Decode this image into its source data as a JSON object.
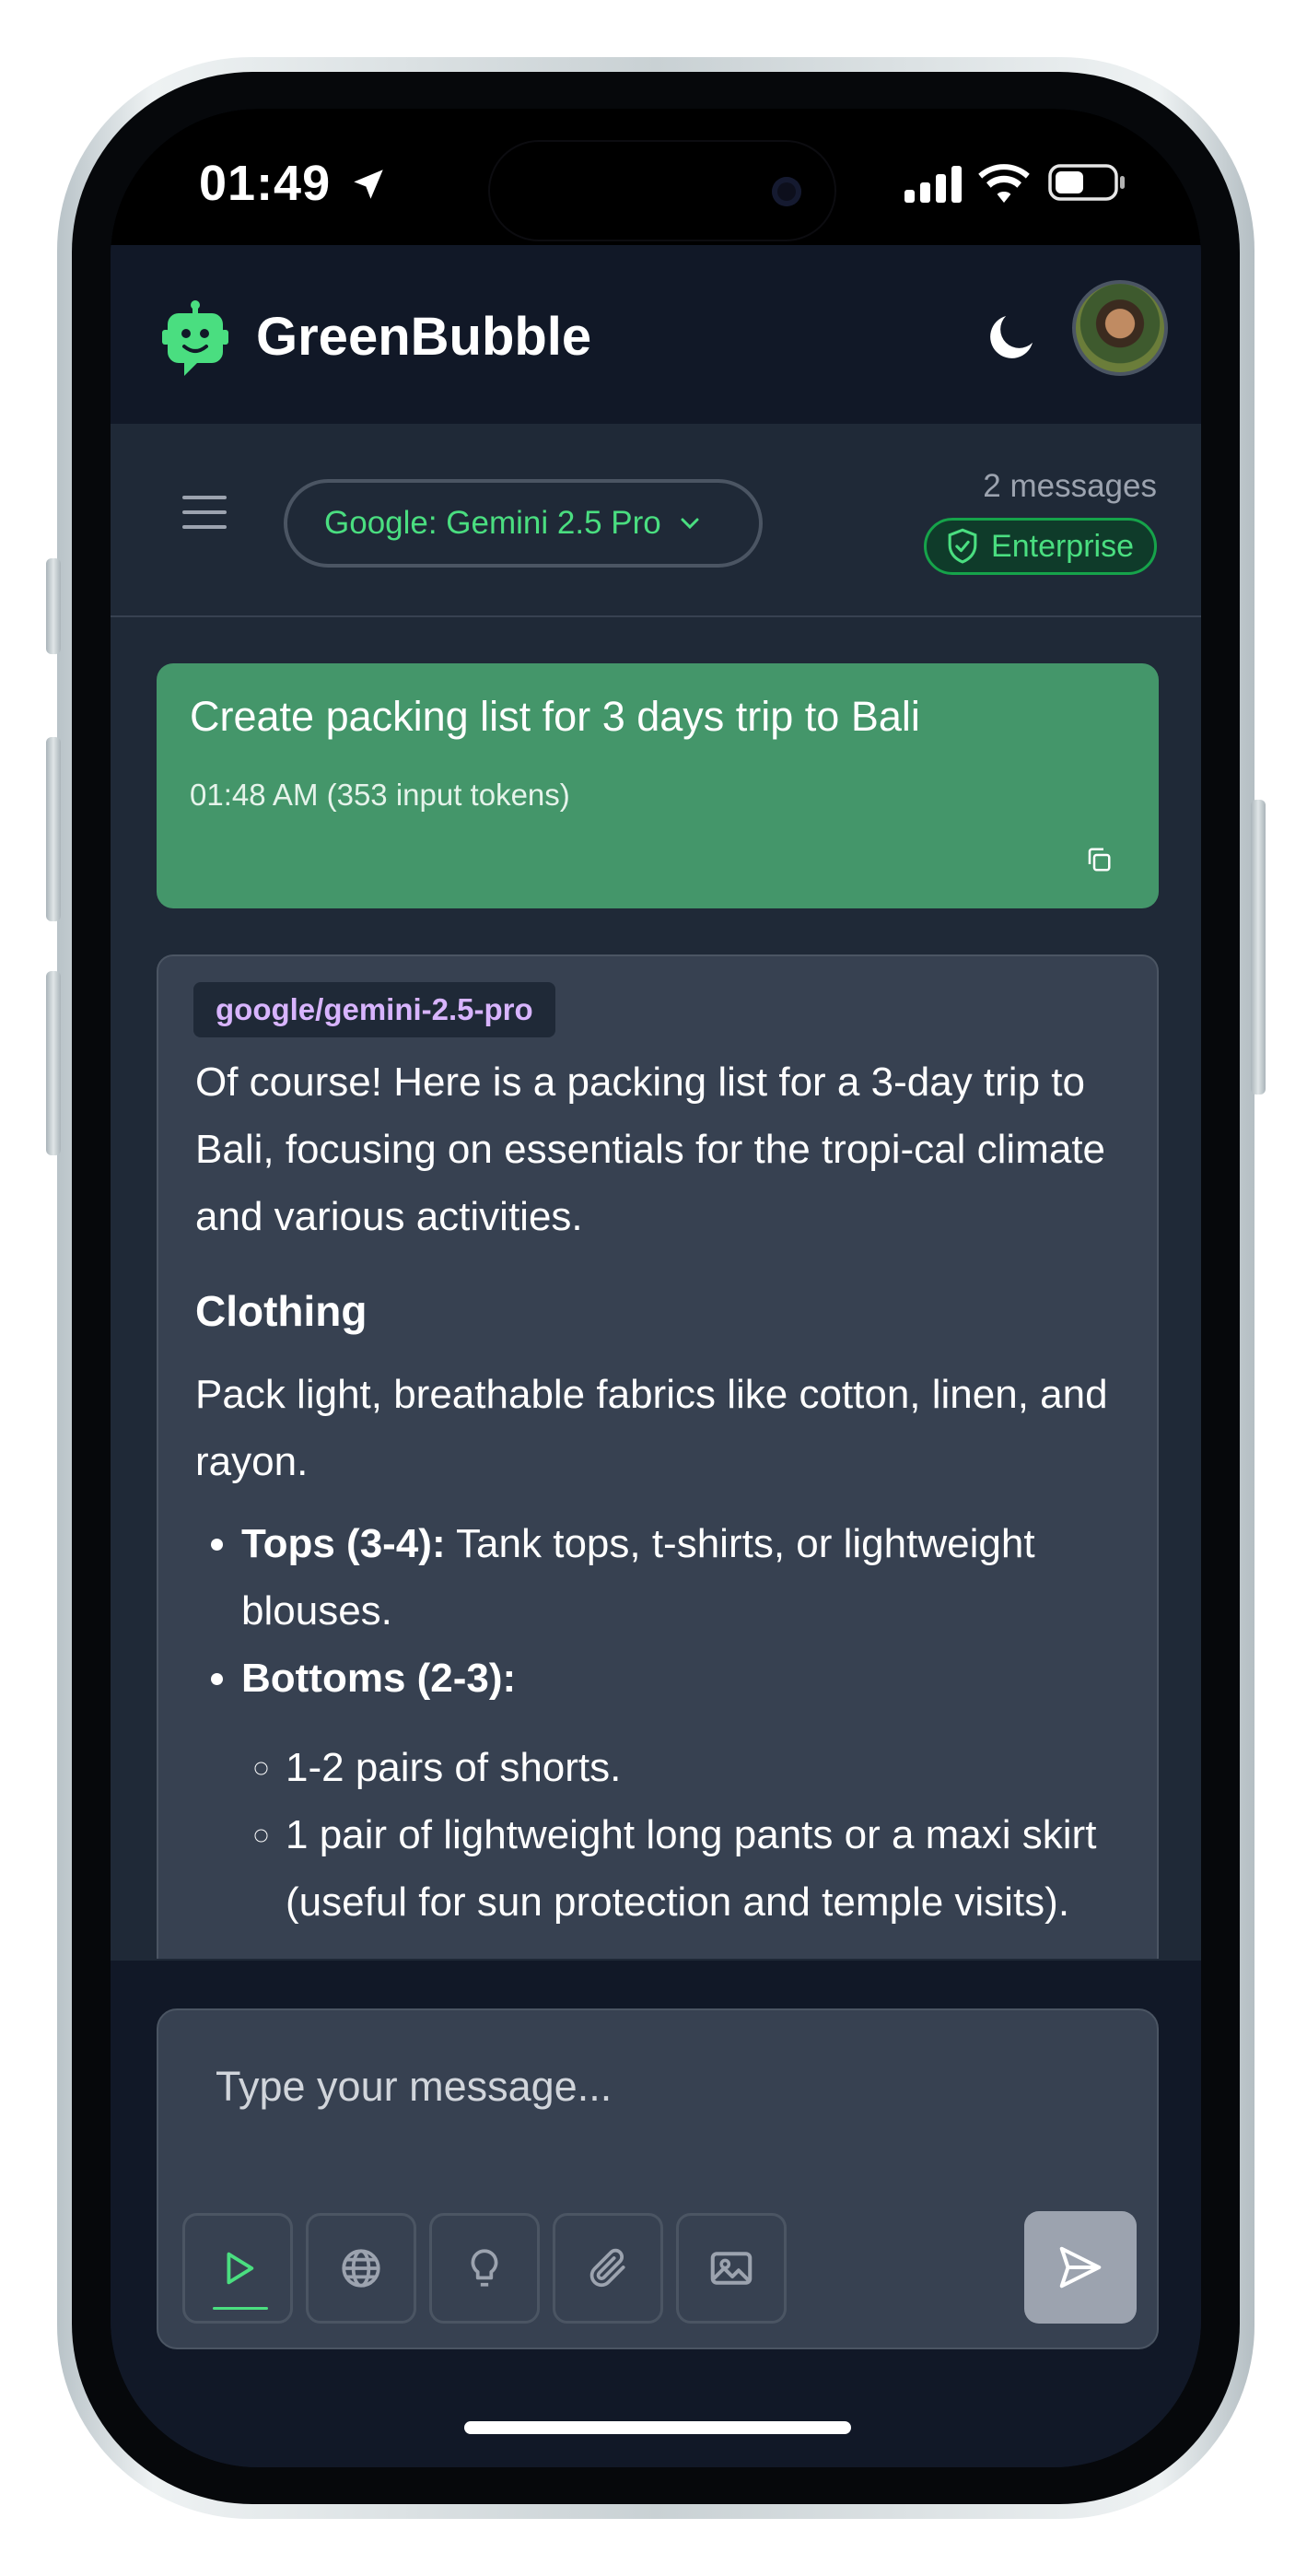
{
  "status_bar": {
    "time": "01:49"
  },
  "header": {
    "app_title": "GreenBubble"
  },
  "toolbar": {
    "model_label": "Google: Gemini 2.5 Pro",
    "message_count": "2 messages",
    "badge_label": "Enterprise"
  },
  "user_message": {
    "text": "Create packing list for 3 days trip to Bali",
    "meta": "01:48 AM (353 input tokens)"
  },
  "ai_message": {
    "model_tag": "google/gemini-2.5-pro",
    "intro": "Of course! Here is a packing list for a 3-day trip to Bali, focusing on essentials for the tropi-cal climate and various activities.",
    "section_title": "Clothing",
    "section_text": "Pack light, breathable fabrics like cotton, linen, and rayon.",
    "items": [
      {
        "label": "Tops (3-4):",
        "text": " Tank tops, t-shirts, or lightweight blouses."
      },
      {
        "label": "Bottoms (2-3):",
        "text": ""
      }
    ],
    "sub_items": [
      "1-2 pairs of shorts.",
      "1 pair of lightweight long pants or a maxi skirt (useful for sun protection and temple visits)."
    ]
  },
  "composer": {
    "placeholder": "Type your message..."
  },
  "colors": {
    "accent_green": "#4ade80",
    "user_bubble": "#44966a",
    "background": "#111827",
    "surface": "#1f2937",
    "card": "#374151",
    "model_tag_text": "#d8b4fe"
  },
  "icons": {
    "logo": "robot-chat-icon",
    "theme_toggle": "moon-icon",
    "menu": "hamburger-icon",
    "dropdown": "chevron-down-icon",
    "badge": "shield-check-icon",
    "copy": "copy-icon",
    "tools": [
      "play-icon",
      "globe-icon",
      "lightbulb-icon",
      "paperclip-icon",
      "image-icon"
    ],
    "send": "send-icon"
  }
}
